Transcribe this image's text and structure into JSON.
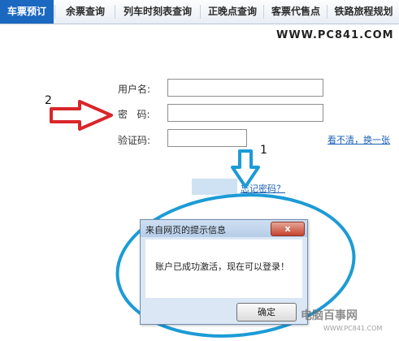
{
  "nav": {
    "tabs": [
      {
        "label": "车票预订"
      },
      {
        "label": "余票查询"
      },
      {
        "label": "列车时刻表查询"
      },
      {
        "label": "正晚点查询"
      },
      {
        "label": "客票代售点"
      },
      {
        "label": "铁路旅程规划"
      }
    ]
  },
  "watermark": "WWW.PC841.COM",
  "form": {
    "username_label": "用户名:",
    "password_label": "密   码:",
    "captcha_label": "验证码:",
    "captcha_refresh_link": "看不清，换一张",
    "forgot_password_link": "忘记密码？"
  },
  "annotations": {
    "arrow_number_left": "2",
    "arrow_number_top": "1",
    "arrow_color": "#d9262a",
    "highlight_color": "#1c9bd6"
  },
  "dialog": {
    "title": "来自网页的提示信息",
    "message": "账户已成功激活，现在可以登录！",
    "ok_label": "确定",
    "close_label": "x"
  },
  "brand": {
    "name": "电脑百事网",
    "url": "WWW.PC841.COM"
  }
}
